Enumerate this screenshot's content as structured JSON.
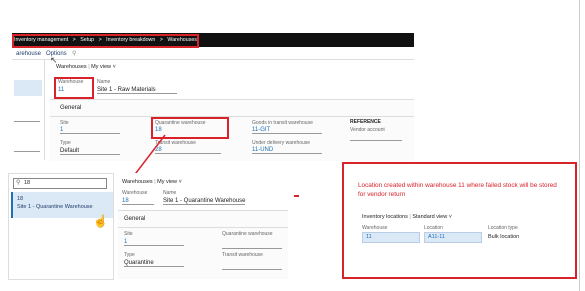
{
  "breadcrumb": [
    "Inventory management",
    "Setup",
    "Inventory breakdown",
    "Warehouses"
  ],
  "menubar": {
    "item1": "arehouse",
    "item2": "Options"
  },
  "form1": {
    "header": "Warehouses",
    "view": "My view",
    "warehouse_label": "Warehouse",
    "warehouse_value": "11",
    "name_label": "Name",
    "name_value": "Site 1 - Raw Materials",
    "section": "General",
    "site_label": "Site",
    "site_value": "1",
    "type_label": "Type",
    "type_value": "Default",
    "quarantine_label": "Quarantine warehouse",
    "quarantine_value": "18",
    "transit_label": "Transit warehouse",
    "transit_value": "28",
    "goods_transit_label": "Goods in transit warehouse",
    "goods_transit_value": "11-GIT",
    "under_delivery_label": "Under delivery warehouse",
    "under_delivery_value": "11-UND",
    "reference_title": "REFERENCE",
    "vendor_account_label": "Vendor account"
  },
  "left2": {
    "search_value": "18",
    "item_id": "18",
    "item_name": "Site 1 - Quarantine Warehouse"
  },
  "form2": {
    "header": "Warehouses",
    "view": "My view",
    "warehouse_label": "Warehouse",
    "warehouse_value": "18",
    "name_label": "Name",
    "name_value": "Site 1 - Quarantine Warehouse",
    "section": "General",
    "site_label": "Site",
    "site_value": "1",
    "type_label": "Type",
    "type_value": "Quarantine",
    "quarantine_label": "Quarantine warehouse",
    "transit_label": "Transit warehouse"
  },
  "callout": {
    "text": "Location created within warehouse 11 where failed stock will be stored for vendor return",
    "header": "Inventory locations",
    "view": "Standard view",
    "col1": "Warehouse",
    "col2": "Location",
    "col3": "Location type",
    "val1": "11",
    "val2": "A11-11",
    "val3": "Bulk location"
  },
  "colors": {
    "accent_red": "#d9222a",
    "link_blue": "#1f6fb5",
    "nav_bg": "#111111"
  }
}
